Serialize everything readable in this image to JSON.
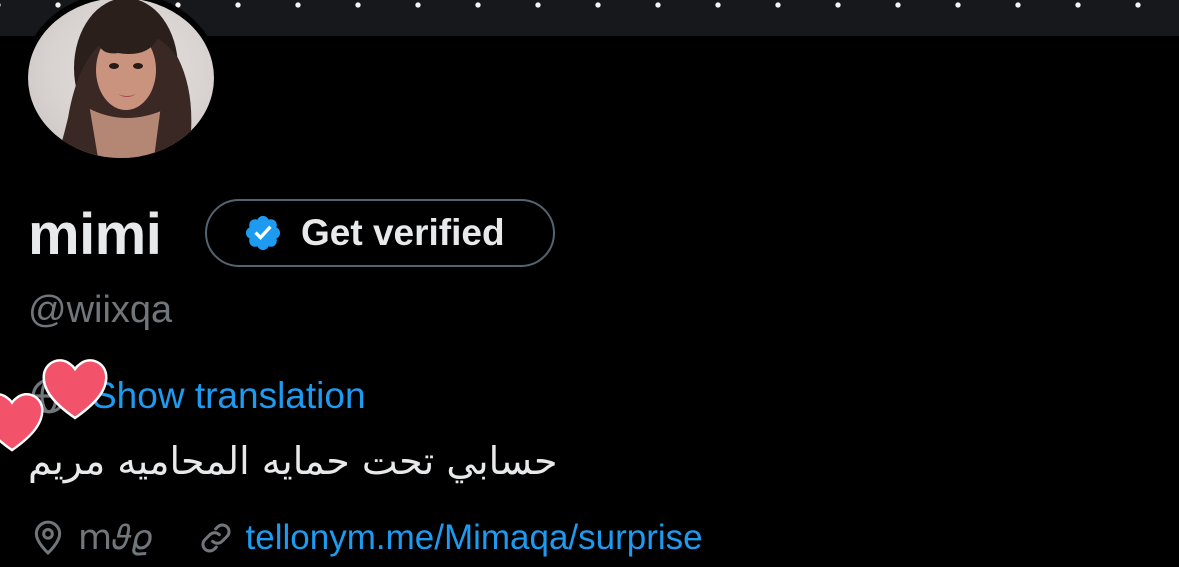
{
  "profile": {
    "name": "mimi",
    "handle": "@wiixqa",
    "verify_label": "Get verified",
    "translate_label": "Show translation",
    "bio": "حسابي تحت حمايه المحاميه مريم",
    "location": "m𝜗𝜚",
    "website": "tellonym.me/Mimaqa/surprise"
  },
  "icons": {
    "badge": "verified-badge-icon",
    "translate": "globe-icon",
    "location": "location-pin-icon",
    "link": "link-icon",
    "sticker": "heart-sticker"
  },
  "colors": {
    "background": "#000000",
    "text_primary": "#e7e9ea",
    "text_secondary": "#71767b",
    "accent": "#1d9bf0",
    "border": "#536471",
    "sticker": "#f2536b"
  }
}
